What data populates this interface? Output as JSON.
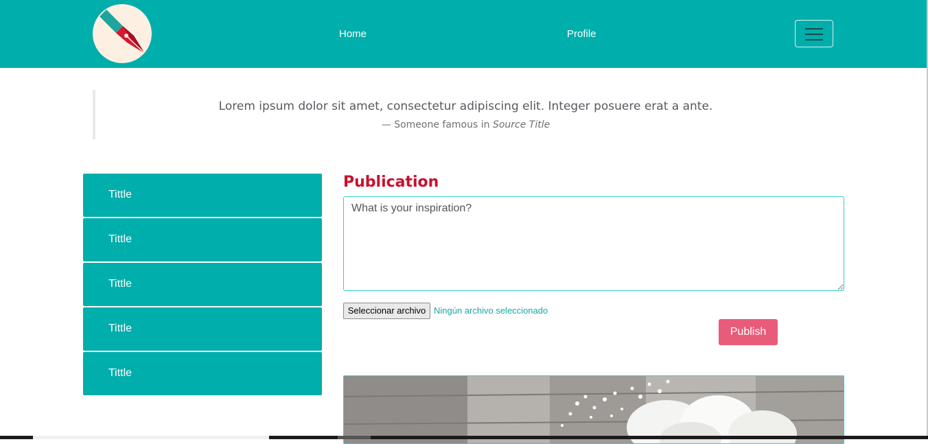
{
  "nav": {
    "logo_icon": "pen-nib-icon",
    "home": "Home",
    "profile": "Profile",
    "menu_icon": "hamburger-menu-icon",
    "brand_color": "#00aeab"
  },
  "quote": {
    "text": "Lorem ipsum dolor sit amet, consectetur adipiscing elit. Integer posuere erat a ante.",
    "attribution": "— Someone famous in ",
    "source": "Source Title"
  },
  "sidebar": {
    "items": [
      {
        "label": "Tittle"
      },
      {
        "label": "Tittle"
      },
      {
        "label": "Tittle"
      },
      {
        "label": "Tittle"
      },
      {
        "label": "Tittle"
      }
    ]
  },
  "publication": {
    "heading": "Publication",
    "placeholder": "What is your inspiration?",
    "file_button": "Seleccionar archivo",
    "file_status": "Ningún archivo seleccionado",
    "publish": "Publish",
    "heading_color": "#c8102e",
    "publish_color": "#e95b7a"
  },
  "post": {
    "image": "white-roses-photo"
  }
}
